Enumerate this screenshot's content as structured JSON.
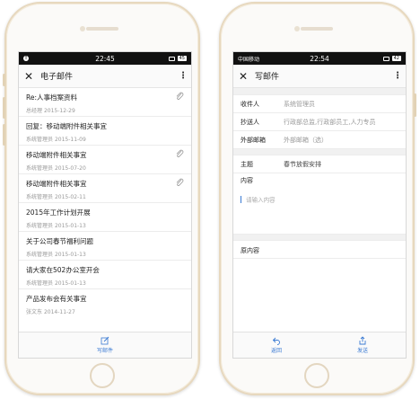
{
  "left": {
    "status": {
      "time": "22:45",
      "battery": "45"
    },
    "title": "电子邮件",
    "mails": [
      {
        "subject": "Re:人事档案资料",
        "sender": "总经理",
        "date": "2015-12-29",
        "attachment": true
      },
      {
        "subject": "回复：移动端附件相关事宜",
        "sender": "系统管理员",
        "date": "2015-11-09",
        "attachment": false
      },
      {
        "subject": "移动端附件相关事宜",
        "sender": "系统管理员",
        "date": "2015-07-20",
        "attachment": true
      },
      {
        "subject": "移动端附件相关事宜",
        "sender": "系统管理员",
        "date": "2015-02-11",
        "attachment": true
      },
      {
        "subject": "2015年工作计划开展",
        "sender": "系统管理员",
        "date": "2015-01-13",
        "attachment": false
      },
      {
        "subject": "关于公司春节福利问题",
        "sender": "系统管理员",
        "date": "2015-01-13",
        "attachment": false
      },
      {
        "subject": "请大家在502办公室开会",
        "sender": "系统管理员",
        "date": "2015-01-13",
        "attachment": false
      },
      {
        "subject": "产品发布会有关事宜",
        "sender": "张文东",
        "date": "2014-11-27",
        "attachment": false
      }
    ],
    "compose_label": "写邮件"
  },
  "right": {
    "status": {
      "carrier": "中国移动",
      "time": "22:54",
      "battery": "42"
    },
    "title": "写邮件",
    "fields": {
      "recipient_label": "收件人",
      "recipient_value": "系统管理员",
      "cc_label": "抄送人",
      "cc_value": "行政部总监,行政部员工,人力专员",
      "external_label": "外部邮箱",
      "external_value": "外部邮箱（选）",
      "subject_label": "主题",
      "subject_value": "春节放假安排",
      "body_label": "内容",
      "body_placeholder": "请输入内容",
      "original_label": "原内容"
    },
    "back_label": "返回",
    "send_label": "发送"
  },
  "colors": {
    "accent": "#3a7ad3",
    "frame": "#e7d8be"
  },
  "icons": [
    "close-icon",
    "more-icon",
    "paperclip-icon",
    "compose-icon",
    "back-icon",
    "send-icon"
  ]
}
